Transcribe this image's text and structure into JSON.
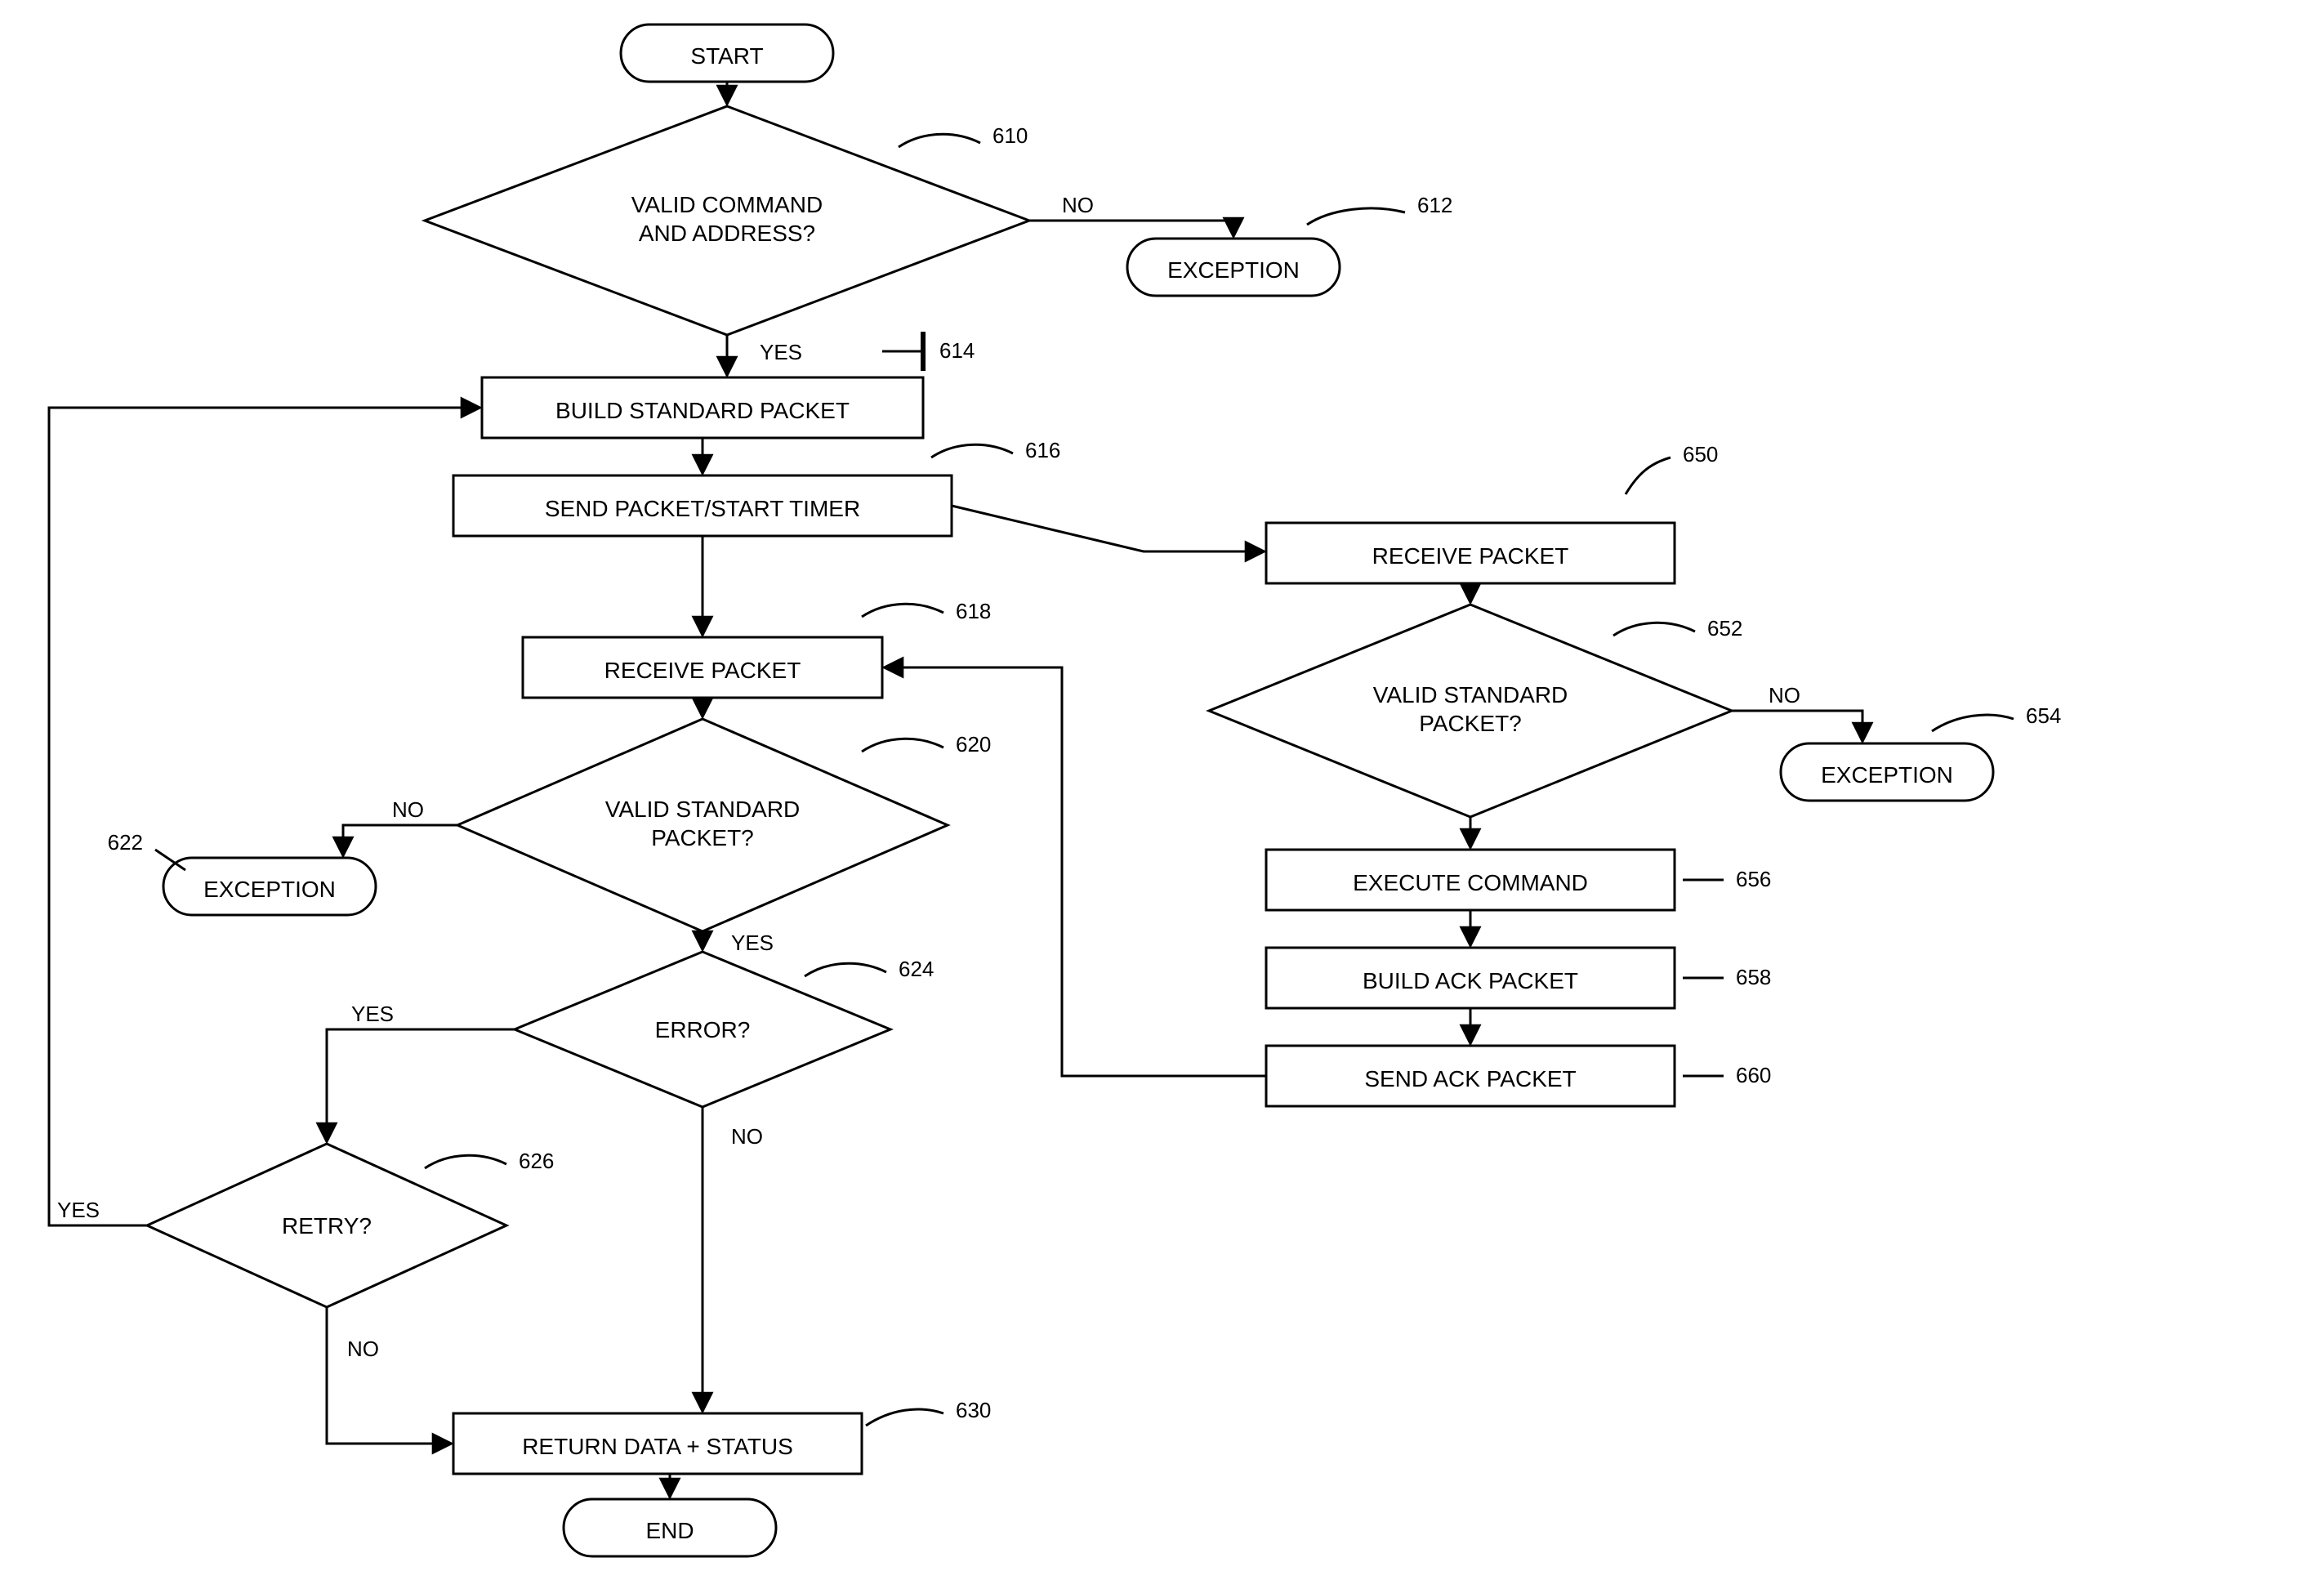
{
  "nodes": {
    "start": {
      "text": "START"
    },
    "d610": {
      "lines": [
        "VALID COMMAND",
        "AND ADDRESS?"
      ],
      "ref": "610"
    },
    "exc612": {
      "text": "EXCEPTION",
      "ref": "612"
    },
    "p614": {
      "text": "BUILD STANDARD PACKET",
      "ref": "614"
    },
    "p616": {
      "text": "SEND PACKET/START TIMER",
      "ref": "616"
    },
    "p618": {
      "text": "RECEIVE PACKET",
      "ref": "618"
    },
    "d620": {
      "lines": [
        "VALID STANDARD",
        "PACKET?"
      ],
      "ref": "620"
    },
    "exc622": {
      "text": "EXCEPTION",
      "ref": "622"
    },
    "d624": {
      "text": "ERROR?",
      "ref": "624"
    },
    "d626": {
      "text": "RETRY?",
      "ref": "626"
    },
    "p630": {
      "text": "RETURN DATA + STATUS",
      "ref": "630"
    },
    "end": {
      "text": "END"
    },
    "p650": {
      "text": "RECEIVE PACKET",
      "ref": "650"
    },
    "d652": {
      "lines": [
        "VALID STANDARD",
        "PACKET?"
      ],
      "ref": "652"
    },
    "exc654": {
      "text": "EXCEPTION",
      "ref": "654"
    },
    "p656": {
      "text": "EXECUTE COMMAND",
      "ref": "656"
    },
    "p658": {
      "text": "BUILD ACK PACKET",
      "ref": "658"
    },
    "p660": {
      "text": "SEND ACK PACKET",
      "ref": "660"
    }
  },
  "edgeLabels": {
    "yes": "YES",
    "no": "NO"
  }
}
